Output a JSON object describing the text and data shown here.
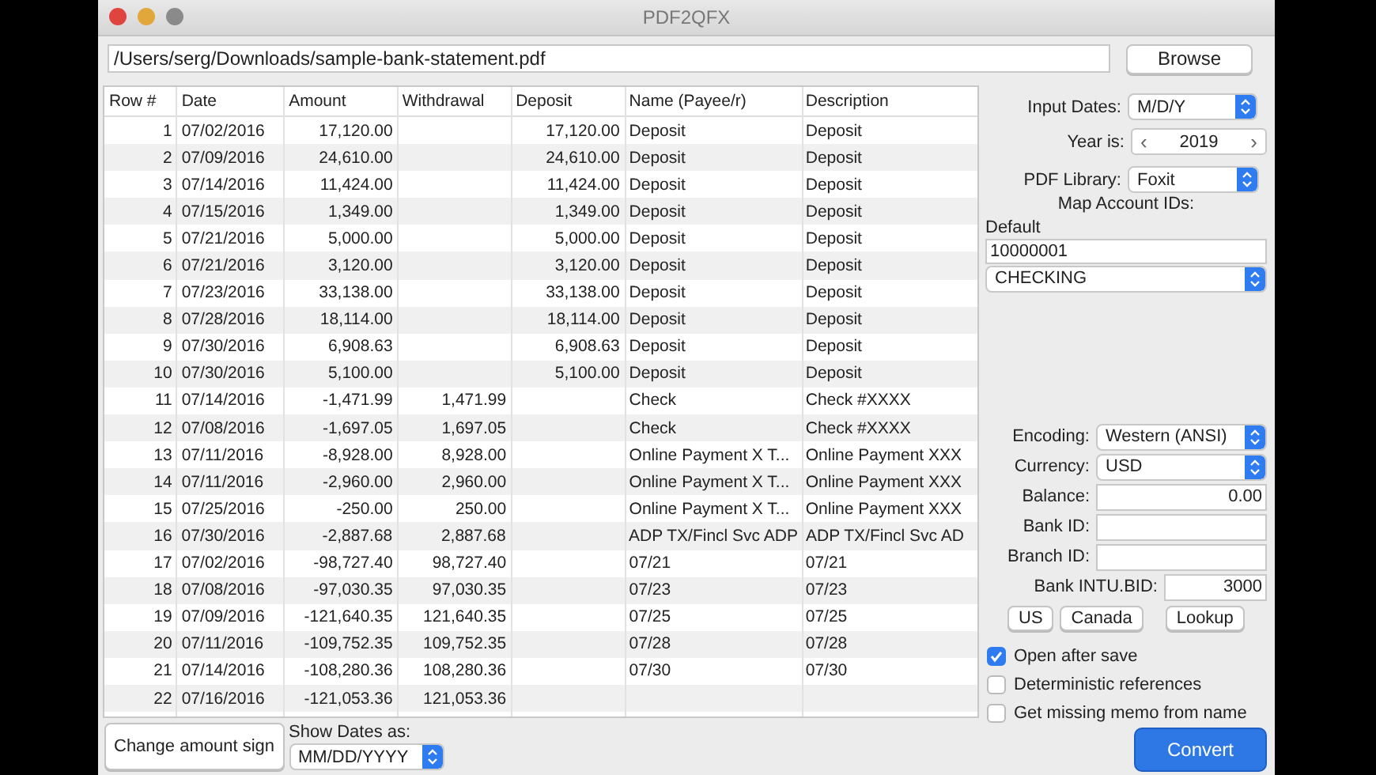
{
  "window": {
    "title": "PDF2QFX"
  },
  "path_field": {
    "value": "/Users/serg/Downloads/sample-bank-statement.pdf"
  },
  "browse_button": "Browse",
  "table": {
    "columns": [
      "Row #",
      "Date",
      "Amount",
      "Withdrawal",
      "Deposit",
      "Name (Payee/r)",
      "Description"
    ],
    "rows": [
      {
        "row": "1",
        "date": "07/02/2016",
        "amount": "17,120.00",
        "deposit": "17,120.00",
        "name": "Deposit",
        "description": "Deposit"
      },
      {
        "row": "2",
        "date": "07/09/2016",
        "amount": "24,610.00",
        "deposit": "24,610.00",
        "name": "Deposit",
        "description": "Deposit"
      },
      {
        "row": "3",
        "date": "07/14/2016",
        "amount": "11,424.00",
        "deposit": "11,424.00",
        "name": "Deposit",
        "description": "Deposit"
      },
      {
        "row": "4",
        "date": "07/15/2016",
        "amount": "1,349.00",
        "deposit": "1,349.00",
        "name": "Deposit",
        "description": "Deposit"
      },
      {
        "row": "5",
        "date": "07/21/2016",
        "amount": "5,000.00",
        "deposit": "5,000.00",
        "name": "Deposit",
        "description": "Deposit"
      },
      {
        "row": "6",
        "date": "07/21/2016",
        "amount": "3,120.00",
        "deposit": "3,120.00",
        "name": "Deposit",
        "description": "Deposit"
      },
      {
        "row": "7",
        "date": "07/23/2016",
        "amount": "33,138.00",
        "deposit": "33,138.00",
        "name": "Deposit",
        "description": "Deposit"
      },
      {
        "row": "8",
        "date": "07/28/2016",
        "amount": "18,114.00",
        "deposit": "18,114.00",
        "name": "Deposit",
        "description": "Deposit"
      },
      {
        "row": "9",
        "date": "07/30/2016",
        "amount": "6,908.63",
        "deposit": "6,908.63",
        "name": "Deposit",
        "description": "Deposit"
      },
      {
        "row": "10",
        "date": "07/30/2016",
        "amount": "5,100.00",
        "deposit": "5,100.00",
        "name": "Deposit",
        "description": "Deposit"
      },
      {
        "row": "11",
        "date": "07/14/2016",
        "amount": "-1,471.99",
        "withdrawal": "1,471.99",
        "name": "Check",
        "description": "Check #XXXX"
      },
      {
        "row": "12",
        "date": "07/08/2016",
        "amount": "-1,697.05",
        "withdrawal": "1,697.05",
        "name": "Check",
        "description": "Check #XXXX"
      },
      {
        "row": "13",
        "date": "07/11/2016",
        "amount": "-8,928.00",
        "withdrawal": "8,928.00",
        "name": "Online Payment X T...",
        "description": "Online Payment XXX"
      },
      {
        "row": "14",
        "date": "07/11/2016",
        "amount": "-2,960.00",
        "withdrawal": "2,960.00",
        "name": "Online Payment X T...",
        "description": "Online Payment XXX"
      },
      {
        "row": "15",
        "date": "07/25/2016",
        "amount": "-250.00",
        "withdrawal": "250.00",
        "name": "Online Payment X T...",
        "description": "Online Payment XXX"
      },
      {
        "row": "16",
        "date": "07/30/2016",
        "amount": "-2,887.68",
        "withdrawal": "2,887.68",
        "name": "ADP TX/Fincl Svc ADP",
        "description": "ADP TX/Fincl Svc AD"
      },
      {
        "row": "17",
        "date": "07/02/2016",
        "amount": "-98,727.40",
        "withdrawal": "98,727.40",
        "name": "07/21",
        "description": "07/21"
      },
      {
        "row": "18",
        "date": "07/08/2016",
        "amount": "-97,030.35",
        "withdrawal": "97,030.35",
        "name": "07/23",
        "description": "07/23"
      },
      {
        "row": "19",
        "date": "07/09/2016",
        "amount": "-121,640.35",
        "withdrawal": "121,640.35",
        "name": "07/25",
        "description": "07/25"
      },
      {
        "row": "20",
        "date": "07/11/2016",
        "amount": "-109,752.35",
        "withdrawal": "109,752.35",
        "name": "07/28",
        "description": "07/28"
      },
      {
        "row": "21",
        "date": "07/14/2016",
        "amount": "-108,280.36",
        "withdrawal": "108,280.36",
        "name": "07/30",
        "description": "07/30"
      },
      {
        "row": "22",
        "date": "07/16/2016",
        "amount": "-121,053.36",
        "withdrawal": "121,053.36"
      }
    ]
  },
  "change_sign_button": "Change amount sign",
  "show_dates": {
    "label": "Show Dates as:",
    "value": "MM/DD/YYYY"
  },
  "settings": {
    "input_dates": {
      "label": "Input Dates:",
      "value": "M/D/Y"
    },
    "year": {
      "label": "Year is:",
      "value": "2019",
      "prev": "‹",
      "next": "›"
    },
    "pdf_library": {
      "label": "PDF Library:",
      "value": "Foxit"
    },
    "map_label": "Map Account IDs:",
    "default_label": "Default",
    "account_id": "10000001",
    "account_type": "CHECKING",
    "encoding": {
      "label": "Encoding:",
      "value": "Western (ANSI)"
    },
    "currency": {
      "label": "Currency:",
      "value": "USD"
    },
    "balance": {
      "label": "Balance:",
      "value": "0.00"
    },
    "bank_id": {
      "label": "Bank ID:"
    },
    "branch_id": {
      "label": "Branch ID:"
    },
    "bank_intu_bid": {
      "label": "Bank INTU.BID:",
      "value": "3000"
    },
    "region_buttons": [
      "US",
      "Canada"
    ],
    "lookup_button": "Lookup",
    "checkboxes": [
      {
        "label": "Open after save",
        "checked": true
      },
      {
        "label": "Deterministic references",
        "checked": false
      },
      {
        "label": "Get missing memo from name",
        "checked": false
      }
    ],
    "convert_button": "Convert"
  }
}
